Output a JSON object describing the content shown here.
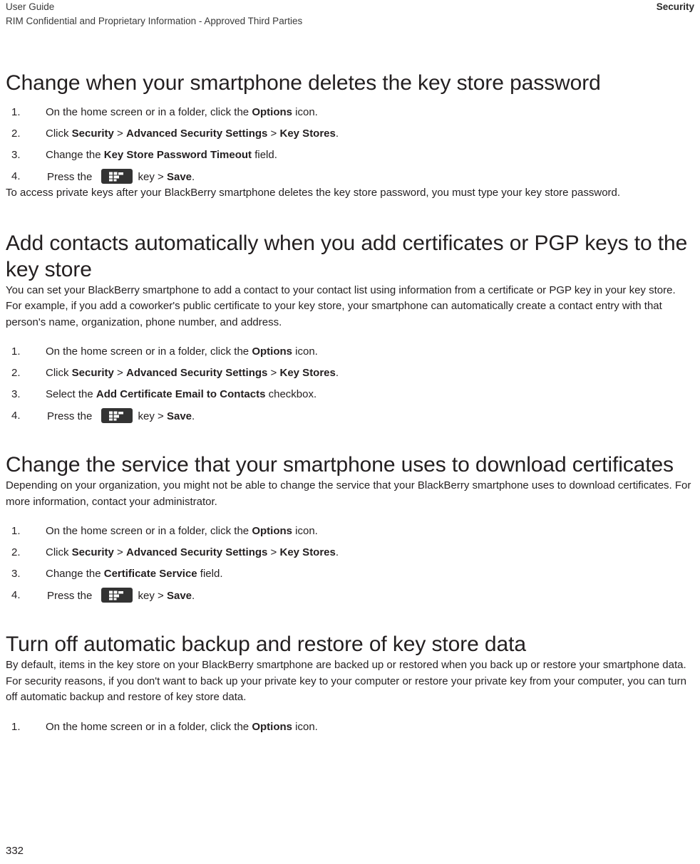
{
  "header": {
    "left_line1": "User Guide",
    "left_line2": "RIM Confidential and Proprietary Information - Approved Third Parties",
    "right": "Security"
  },
  "sections": [
    {
      "heading": "Change when your smartphone deletes the key store password",
      "steps": [
        {
          "num": "1.",
          "pre": "On the home screen or in a folder, click the ",
          "bold1": "Options",
          "post": " icon."
        },
        {
          "num": "2.",
          "pre": "Click ",
          "bold1": "Security",
          "sep1": " > ",
          "bold2": "Advanced Security Settings",
          "sep2": " > ",
          "bold3": "Key Stores",
          "post": "."
        },
        {
          "num": "3.",
          "pre": "Change the ",
          "bold1": "Key Store Password Timeout",
          "post": " field."
        },
        {
          "num": "4.",
          "pre": "Press the ",
          "key_icon": "blackberry-menu-key-icon",
          "mid": "key > ",
          "bold1": "Save",
          "post": "."
        }
      ],
      "paragraph_after": "To access private keys after your BlackBerry smartphone deletes the key store password, you must type your key store password."
    },
    {
      "heading": "Add contacts automatically when you add certificates or PGP keys to the key store",
      "paragraph_before": "You can set your BlackBerry smartphone to add a contact to your contact list using information from a certificate or PGP key in your key store. For example, if you add a coworker's public certificate to your key store, your smartphone can automatically create a contact entry with that person's name, organization, phone number, and address.",
      "steps": [
        {
          "num": "1.",
          "pre": "On the home screen or in a folder, click the ",
          "bold1": "Options",
          "post": " icon."
        },
        {
          "num": "2.",
          "pre": "Click ",
          "bold1": "Security",
          "sep1": " > ",
          "bold2": "Advanced Security Settings",
          "sep2": " > ",
          "bold3": "Key Stores",
          "post": "."
        },
        {
          "num": "3.",
          "pre": "Select the ",
          "bold1": "Add Certificate Email to Contacts",
          "post": " checkbox."
        },
        {
          "num": "4.",
          "pre": "Press the ",
          "key_icon": "blackberry-menu-key-icon",
          "mid": "key > ",
          "bold1": "Save",
          "post": "."
        }
      ]
    },
    {
      "heading": "Change the service that your smartphone uses to download certificates",
      "paragraph_before": "Depending on your organization, you might not be able to change the service that your BlackBerry smartphone uses to download certificates. For more information, contact your administrator.",
      "steps": [
        {
          "num": "1.",
          "pre": "On the home screen or in a folder, click the ",
          "bold1": "Options",
          "post": " icon."
        },
        {
          "num": "2.",
          "pre": "Click ",
          "bold1": "Security",
          "sep1": " > ",
          "bold2": "Advanced Security Settings",
          "sep2": " > ",
          "bold3": "Key Stores",
          "post": "."
        },
        {
          "num": "3.",
          "pre": "Change the ",
          "bold1": "Certificate Service",
          "post": " field."
        },
        {
          "num": "4.",
          "pre": "Press the ",
          "key_icon": "blackberry-menu-key-icon",
          "mid": "key > ",
          "bold1": "Save",
          "post": "."
        }
      ]
    },
    {
      "heading": "Turn off automatic backup and restore of key store data",
      "paragraph_before": "By default, items in the key store on your BlackBerry smartphone are backed up or restored when you back up or restore your smartphone data. For security reasons, if you don't want to back up your private key to your computer or restore your private key from your computer, you can turn off automatic backup and restore of key store data.",
      "steps": [
        {
          "num": "1.",
          "pre": "On the home screen or in a folder, click the ",
          "bold1": "Options",
          "post": " icon."
        }
      ]
    }
  ],
  "footer": {
    "page_number": "332"
  },
  "colors": {
    "text": "#231f20",
    "key_icon_bg": "#333333",
    "key_icon_fg": "#ffffff"
  }
}
